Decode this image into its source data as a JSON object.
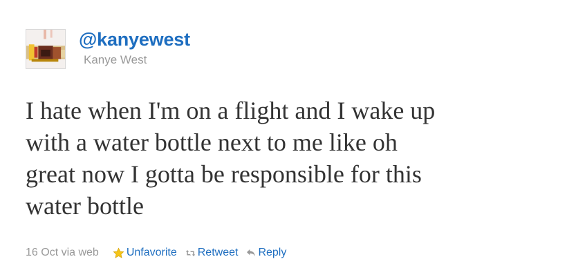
{
  "tweet": {
    "handle": "@kanyewest",
    "name": "Kanye West",
    "text_lines": [
      "I hate when I'm on a flight and I wake up",
      "with a water bottle next to me like oh",
      "great now I gotta be responsible for this",
      "water bottle"
    ],
    "timestamp": "16 Oct via web",
    "actions": {
      "unfavorite_label": "Unfavorite",
      "retweet_label": "Retweet",
      "reply_label": "Reply"
    },
    "icons": {
      "avatar": "avatar-image",
      "favorite": "star-icon",
      "retweet": "retweet-icon",
      "reply": "reply-icon"
    },
    "colors": {
      "link": "#1e6ec0",
      "favorite_star": "#f5c518",
      "muted": "#999999",
      "text": "#333333"
    }
  }
}
